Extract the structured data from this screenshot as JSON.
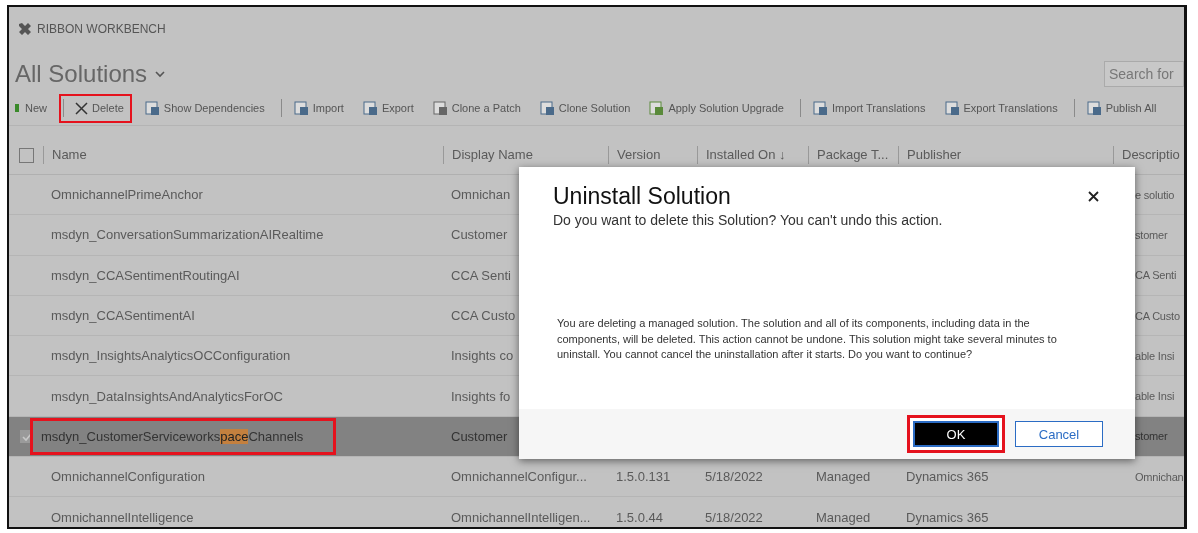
{
  "app_title": "RIBBON WORKBENCH",
  "view": {
    "title": "All Solutions",
    "expanded": false
  },
  "search": {
    "placeholder": "Search for"
  },
  "toolbar": [
    {
      "kind": "new",
      "label": "New",
      "annotated": false,
      "group_start": false
    },
    {
      "kind": "delete",
      "label": "Delete",
      "annotated": true,
      "group_start": true
    },
    {
      "kind": "dependencies",
      "label": "Show Dependencies",
      "annotated": false,
      "group_start": false
    },
    {
      "kind": "import",
      "label": "Import",
      "annotated": false,
      "group_start": true
    },
    {
      "kind": "export",
      "label": "Export",
      "annotated": false,
      "group_start": false
    },
    {
      "kind": "clone",
      "label": "Clone a Patch",
      "annotated": false,
      "group_start": false
    },
    {
      "kind": "grid",
      "label": "Clone Solution",
      "annotated": false,
      "group_start": false
    },
    {
      "kind": "upgrade",
      "label": "Apply Solution Upgrade",
      "annotated": false,
      "group_start": false
    },
    {
      "kind": "import",
      "label": "Import Translations",
      "annotated": false,
      "group_start": true
    },
    {
      "kind": "export",
      "label": "Export Translations",
      "annotated": false,
      "group_start": false
    },
    {
      "kind": "publish",
      "label": "Publish All",
      "annotated": false,
      "group_start": true
    }
  ],
  "table": {
    "select_all": false,
    "columns": [
      "Name",
      "Display Name",
      "Version",
      "Installed On ↓",
      "Package T...",
      "Publisher",
      "Descriptio"
    ],
    "rows": [
      {
        "selected": false,
        "annotated": false,
        "name": "OmnichannelPrimeAnchor",
        "display_name": "Omnichan",
        "description": "e solutio"
      },
      {
        "selected": false,
        "annotated": false,
        "name": "msdyn_ConversationSummarizationAIRealtime",
        "display_name": "Customer",
        "description": "stomer"
      },
      {
        "selected": false,
        "annotated": false,
        "name": "msdyn_CCASentimentRoutingAI",
        "display_name": "CCA Senti",
        "description": "CA Senti"
      },
      {
        "selected": false,
        "annotated": false,
        "name": "msdyn_CCASentimentAI",
        "display_name": "CCA Custo",
        "description": "CA Custo"
      },
      {
        "selected": false,
        "annotated": false,
        "name": "msdyn_InsightsAnalyticsOCConfiguration",
        "display_name": "Insights co",
        "description": "able Insi"
      },
      {
        "selected": false,
        "annotated": false,
        "name": "msdyn_DataInsightsAndAnalyticsForOC",
        "display_name": "Insights fo",
        "description": "able Insi"
      },
      {
        "selected": true,
        "annotated": true,
        "name": "msdyn_CustomerServiceworks",
        "name_match": "pace",
        "name_after": "Channels",
        "display_name": "Customer",
        "description": "stomer"
      },
      {
        "selected": false,
        "annotated": false,
        "name": "OmnichannelConfiguration",
        "display_name": "OmnichannelConfigur...",
        "version": "1.5.0.131",
        "installed_on": "5/18/2022",
        "package_type": "Managed",
        "publisher": "Dynamics 365",
        "description": "Omnichan"
      },
      {
        "selected": false,
        "annotated": false,
        "name": "OmnichannelIntelligence",
        "display_name": "OmnichannelIntelligen...",
        "version": "1.5.0.44",
        "installed_on": "5/18/2022",
        "package_type": "Managed",
        "publisher": "Dynamics 365"
      }
    ]
  },
  "dialog": {
    "title": "Uninstall Solution",
    "subtitle": "Do you want to delete this Solution? You can't undo this action.",
    "message": "You are deleting a managed solution. The solution and all of its components, including data in the components, will be deleted. This action cannot be undone. This solution might take several minutes to uninstall. You cannot cancel the uninstallation after it starts. Do you want to continue?",
    "buttons": [
      {
        "kind": "primary",
        "label": "OK",
        "annotated": true
      },
      {
        "kind": "secondary",
        "label": "Cancel",
        "annotated": false
      }
    ]
  }
}
